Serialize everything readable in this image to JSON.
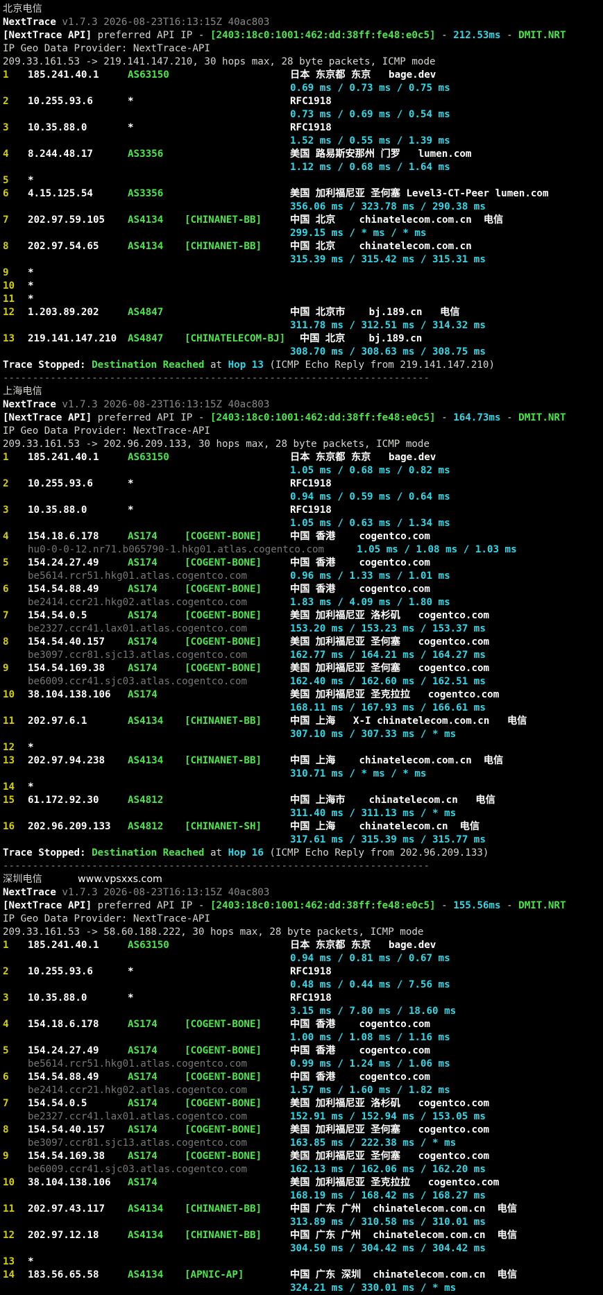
{
  "colors": {
    "background": "#000000",
    "hop_number": "#d4d000",
    "ip": "#ffffff",
    "asn": "#4ae64a",
    "rtt": "#2fd8e6",
    "hostname": "#777777"
  },
  "sections": [
    {
      "title": "北京电信",
      "watermark": "",
      "version_prefix": "NextTrace",
      "version_info": "v1.7.3 2026-08-23T16:13:15Z 40ac803",
      "api_prefix": "[NextTrace API]",
      "api_middle": " preferred API IP - ",
      "api_ip": "[2403:18c0:1001:462:dd:38ff:fe48:e0c5]",
      "api_sep1": " - ",
      "api_latency": "212.53ms",
      "api_sep2": " - ",
      "api_node": "DMIT.NRT",
      "geo_provider": "IP Geo Data Provider: NextTrace-API",
      "trace_header": "209.33.161.53 -> 219.141.147.210, 30 hops max, 28 byte packets, ICMP mode",
      "hops": [
        {
          "n": "1",
          "ip": "185.241.40.1",
          "asn": "AS63150",
          "tag": "",
          "geo": "日本 东京都 东京   bage.dev",
          "host": "",
          "rtt": "0.69 ms / 0.73 ms / 0.75 ms"
        },
        {
          "n": "2",
          "ip": "10.255.93.6",
          "asn": "*",
          "tag": "",
          "geo": "RFC1918",
          "host": "",
          "rtt": "0.73 ms / 0.69 ms / 0.54 ms"
        },
        {
          "n": "3",
          "ip": "10.35.88.0",
          "asn": "*",
          "tag": "",
          "geo": "RFC1918",
          "host": "",
          "rtt": "1.52 ms / 0.55 ms / 1.39 ms"
        },
        {
          "n": "4",
          "ip": "8.244.48.17",
          "asn": "AS3356",
          "tag": "",
          "geo": "美国 路易斯安那州 门罗   lumen.com",
          "host": "",
          "rtt": "1.12 ms / 0.68 ms / 1.64 ms"
        },
        {
          "n": "5",
          "star": true
        },
        {
          "n": "6",
          "ip": "4.15.125.54",
          "asn": "AS3356",
          "tag": "",
          "geo": "美国 加利福尼亚 圣何塞 Level3-CT-Peer lumen.com",
          "host": "",
          "rtt": "356.06 ms / 323.78 ms / 290.38 ms"
        },
        {
          "n": "7",
          "ip": "202.97.59.105",
          "asn": "AS4134",
          "tag": "[CHINANET-BB]",
          "geo": "中国 北京    chinatelecom.com.cn  电信",
          "host": "",
          "rtt": "299.15 ms / * ms / * ms"
        },
        {
          "n": "8",
          "ip": "202.97.54.65",
          "asn": "AS4134",
          "tag": "[CHINANET-BB]",
          "geo": "中国 北京    chinatelecom.com.cn",
          "host": "",
          "rtt": "315.39 ms / 315.42 ms / 315.31 ms"
        },
        {
          "n": "9",
          "star": true
        },
        {
          "n": "10",
          "star": true
        },
        {
          "n": "11",
          "star": true
        },
        {
          "n": "12",
          "ip": "1.203.89.202",
          "asn": "AS4847",
          "tag": "",
          "geo": "中国 北京市    bj.189.cn   电信",
          "host": "",
          "rtt": "311.78 ms / 312.51 ms / 314.32 ms"
        },
        {
          "n": "13",
          "ip": "219.141.147.210",
          "asn": "AS4847",
          "tag": "[CHINATELECOM-BJ]",
          "geo": "中国 北京    bj.189.cn",
          "host": "",
          "rtt": "308.70 ms / 308.63 ms / 308.75 ms",
          "tag_shift": true
        }
      ],
      "stop_label": "Trace Stopped:",
      "stop_reason": "Destination Reached",
      "stop_at": "at",
      "stop_hop": "Hop 13",
      "stop_tail": "(ICMP Echo Reply from 219.141.147.210)",
      "separator": "------------------------------------------------------------------------"
    },
    {
      "title": "上海电信",
      "watermark": "",
      "version_prefix": "NextTrace",
      "version_info": "v1.7.3 2026-08-23T16:13:15Z 40ac803",
      "api_prefix": "[NextTrace API]",
      "api_middle": " preferred API IP - ",
      "api_ip": "[2403:18c0:1001:462:dd:38ff:fe48:e0c5]",
      "api_sep1": " - ",
      "api_latency": "164.73ms",
      "api_sep2": " - ",
      "api_node": "DMIT.NRT",
      "geo_provider": "IP Geo Data Provider: NextTrace-API",
      "trace_header": "209.33.161.53 -> 202.96.209.133, 30 hops max, 28 byte packets, ICMP mode",
      "hops": [
        {
          "n": "1",
          "ip": "185.241.40.1",
          "asn": "AS63150",
          "tag": "",
          "geo": "日本 东京都 东京   bage.dev",
          "host": "",
          "rtt": "1.05 ms / 0.68 ms / 0.82 ms"
        },
        {
          "n": "2",
          "ip": "10.255.93.6",
          "asn": "*",
          "tag": "",
          "geo": "RFC1918",
          "host": "",
          "rtt": "0.94 ms / 0.59 ms / 0.64 ms"
        },
        {
          "n": "3",
          "ip": "10.35.88.0",
          "asn": "*",
          "tag": "",
          "geo": "RFC1918",
          "host": "",
          "rtt": "1.05 ms / 0.63 ms / 1.34 ms"
        },
        {
          "n": "4",
          "ip": "154.18.6.178",
          "asn": "AS174",
          "tag": "[COGENT-BONE]",
          "geo": "中国 香港    cogentco.com",
          "host": "hu0-0-0-12.nr71.b065790-1.hkg01.atlas.cogentco.com",
          "rtt": "1.05 ms / 1.08 ms / 1.03 ms",
          "rtt_wide": true
        },
        {
          "n": "5",
          "ip": "154.24.27.49",
          "asn": "AS174",
          "tag": "[COGENT-BONE]",
          "geo": "中国 香港    cogentco.com",
          "host": "be5614.rcr51.hkg01.atlas.cogentco.com",
          "rtt": "0.96 ms / 1.33 ms / 1.01 ms"
        },
        {
          "n": "6",
          "ip": "154.54.88.49",
          "asn": "AS174",
          "tag": "[COGENT-BONE]",
          "geo": "中国 香港    cogentco.com",
          "host": "be2414.ccr21.hkg02.atlas.cogentco.com",
          "rtt": "1.83 ms / 4.09 ms / 1.80 ms"
        },
        {
          "n": "7",
          "ip": "154.54.0.5",
          "asn": "AS174",
          "tag": "[COGENT-BONE]",
          "geo": "美国 加利福尼亚 洛杉矶   cogentco.com",
          "host": "be2327.ccr41.lax01.atlas.cogentco.com",
          "rtt": "153.20 ms / 153.23 ms / 153.37 ms"
        },
        {
          "n": "8",
          "ip": "154.54.40.157",
          "asn": "AS174",
          "tag": "[COGENT-BONE]",
          "geo": "美国 加利福尼亚 圣何塞   cogentco.com",
          "host": "be3097.ccr81.sjc13.atlas.cogentco.com",
          "rtt": "162.77 ms / 164.21 ms / 164.27 ms"
        },
        {
          "n": "9",
          "ip": "154.54.169.38",
          "asn": "AS174",
          "tag": "[COGENT-BONE]",
          "geo": "美国 加利福尼亚 圣何塞   cogentco.com",
          "host": "be6009.ccr41.sjc03.atlas.cogentco.com",
          "rtt": "162.40 ms / 162.60 ms / 162.51 ms"
        },
        {
          "n": "10",
          "ip": "38.104.138.106",
          "asn": "AS174",
          "tag": "",
          "geo": "美国 加利福尼亚 圣克拉拉   cogentco.com",
          "host": "",
          "rtt": "168.11 ms / 167.93 ms / 166.61 ms"
        },
        {
          "n": "11",
          "ip": "202.97.6.1",
          "asn": "AS4134",
          "tag": "[CHINANET-BB]",
          "geo": "中国 上海   X-I chinatelecom.com.cn   电信",
          "host": "",
          "rtt": "307.10 ms / 307.33 ms / * ms"
        },
        {
          "n": "12",
          "star": true
        },
        {
          "n": "13",
          "ip": "202.97.94.238",
          "asn": "AS4134",
          "tag": "[CHINANET-BB]",
          "geo": "中国 上海    chinatelecom.com.cn  电信",
          "host": "",
          "rtt": "310.71 ms / * ms / * ms"
        },
        {
          "n": "14",
          "star": true
        },
        {
          "n": "15",
          "ip": "61.172.92.30",
          "asn": "AS4812",
          "tag": "",
          "geo": "中国 上海市    chinatelecom.cn   电信",
          "host": "",
          "rtt": "311.40 ms / 311.13 ms / * ms"
        },
        {
          "n": "16",
          "ip": "202.96.209.133",
          "asn": "AS4812",
          "tag": "[CHINANET-SH]",
          "geo": "中国 上海    chinatelecom.cn  电信",
          "host": "",
          "rtt": "317.61 ms / 315.39 ms / 315.77 ms"
        }
      ],
      "stop_label": "Trace Stopped:",
      "stop_reason": "Destination Reached",
      "stop_at": "at",
      "stop_hop": "Hop 16",
      "stop_tail": "(ICMP Echo Reply from 202.96.209.133)",
      "separator": "------------------------------------------------------------------------"
    },
    {
      "title": "深圳电信",
      "watermark": "www.vpsxxs.com",
      "version_prefix": "NextTrace",
      "version_info": "v1.7.3 2026-08-23T16:13:15Z 40ac803",
      "api_prefix": "[NextTrace API]",
      "api_middle": " preferred API IP - ",
      "api_ip": "[2403:18c0:1001:462:dd:38ff:fe48:e0c5]",
      "api_sep1": " - ",
      "api_latency": "155.56ms",
      "api_sep2": " - ",
      "api_node": "DMIT.NRT",
      "geo_provider": "IP Geo Data Provider: NextTrace-API",
      "trace_header": "209.33.161.53 -> 58.60.188.222, 30 hops max, 28 byte packets, ICMP mode",
      "hops": [
        {
          "n": "1",
          "ip": "185.241.40.1",
          "asn": "AS63150",
          "tag": "",
          "geo": "日本 东京都 东京   bage.dev",
          "host": "",
          "rtt": "0.94 ms / 0.81 ms / 0.67 ms"
        },
        {
          "n": "2",
          "ip": "10.255.93.6",
          "asn": "*",
          "tag": "",
          "geo": "RFC1918",
          "host": "",
          "rtt": "0.48 ms / 0.44 ms / 7.56 ms"
        },
        {
          "n": "3",
          "ip": "10.35.88.0",
          "asn": "*",
          "tag": "",
          "geo": "RFC1918",
          "host": "",
          "rtt": "3.15 ms / 7.80 ms / 18.60 ms"
        },
        {
          "n": "4",
          "ip": "154.18.6.178",
          "asn": "AS174",
          "tag": "[COGENT-BONE]",
          "geo": "中国 香港    cogentco.com",
          "host": "",
          "rtt": "1.00 ms / 1.08 ms / 1.16 ms"
        },
        {
          "n": "5",
          "ip": "154.24.27.49",
          "asn": "AS174",
          "tag": "[COGENT-BONE]",
          "geo": "中国 香港    cogentco.com",
          "host": "be5614.rcr51.hkg01.atlas.cogentco.com",
          "rtt": "0.99 ms / 1.24 ms / 1.06 ms"
        },
        {
          "n": "6",
          "ip": "154.54.88.49",
          "asn": "AS174",
          "tag": "[COGENT-BONE]",
          "geo": "中国 香港    cogentco.com",
          "host": "be2414.ccr21.hkg02.atlas.cogentco.com",
          "rtt": "1.57 ms / 1.60 ms / 1.82 ms"
        },
        {
          "n": "7",
          "ip": "154.54.0.5",
          "asn": "AS174",
          "tag": "[COGENT-BONE]",
          "geo": "美国 加利福尼亚 洛杉矶   cogentco.com",
          "host": "be2327.ccr41.lax01.atlas.cogentco.com",
          "rtt": "152.91 ms / 152.94 ms / 153.05 ms"
        },
        {
          "n": "8",
          "ip": "154.54.40.157",
          "asn": "AS174",
          "tag": "[COGENT-BONE]",
          "geo": "美国 加利福尼亚 圣何塞   cogentco.com",
          "host": "be3097.ccr81.sjc13.atlas.cogentco.com",
          "rtt": "163.85 ms / 222.38 ms / * ms"
        },
        {
          "n": "9",
          "ip": "154.54.169.38",
          "asn": "AS174",
          "tag": "[COGENT-BONE]",
          "geo": "美国 加利福尼亚 圣何塞   cogentco.com",
          "host": "be6009.ccr41.sjc03.atlas.cogentco.com",
          "rtt": "162.13 ms / 162.06 ms / 162.20 ms"
        },
        {
          "n": "10",
          "ip": "38.104.138.106",
          "asn": "AS174",
          "tag": "",
          "geo": "美国 加利福尼亚 圣克拉拉   cogentco.com",
          "host": "",
          "rtt": "168.19 ms / 168.42 ms / 168.27 ms"
        },
        {
          "n": "11",
          "ip": "202.97.43.117",
          "asn": "AS4134",
          "tag": "[CHINANET-BB]",
          "geo": "中国 广东 广州  chinatelecom.com.cn  电信",
          "host": "",
          "rtt": "313.89 ms / 310.58 ms / 310.01 ms"
        },
        {
          "n": "12",
          "ip": "202.97.12.18",
          "asn": "AS4134",
          "tag": "[CHINANET-BB]",
          "geo": "中国 广东 广州  chinatelecom.com.cn  电信",
          "host": "",
          "rtt": "304.50 ms / 304.42 ms / 304.42 ms"
        },
        {
          "n": "13",
          "star": true
        },
        {
          "n": "14",
          "ip": "183.56.65.58",
          "asn": "AS4134",
          "tag": "[APNIC-AP]",
          "geo": "中国 广东 深圳  chinatelecom.com.cn  电信",
          "host": "",
          "rtt": "324.21 ms / 330.01 ms / * ms"
        }
      ]
    }
  ]
}
